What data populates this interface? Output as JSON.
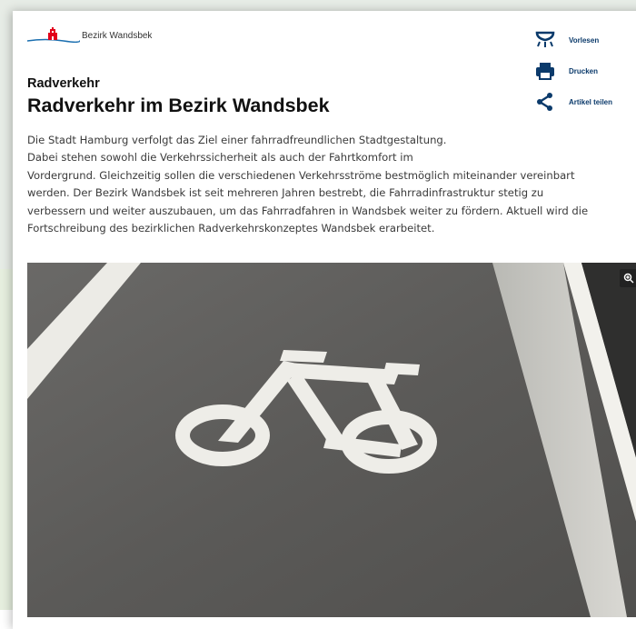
{
  "header": {
    "logo_text": "Bezirk Wandsbek",
    "brand_color": "#e2001a"
  },
  "article": {
    "kicker": "Radverkehr",
    "title": "Radverkehr im Bezirk Wandsbek",
    "paragraph_lines": [
      "Die Stadt Hamburg verfolgt das Ziel einer fahrradfreundlichen Stadtgestaltung.",
      "Dabei stehen sowohl die Verkehrssicherheit als auch der Fahrtkomfort im",
      "Vordergrund. Gleichzeitig sollen die verschiedenen Verkehrsströme bestmöglich miteinander vereinbart",
      "werden. Der Bezirk Wandsbek ist seit mehreren Jahren bestrebt, die Fahrradinfrastruktur stetig zu",
      "verbessern und weiter auszubauen, um das Fahrradfahren in Wandsbek weiter zu fördern. Aktuell wird die",
      "Fortschreibung des bezirklichen Radverkehrskonzeptes Wandsbek erarbeitet."
    ]
  },
  "actions": [
    {
      "label": "Vorlesen",
      "icon": "speaker-icon"
    },
    {
      "label": "Drucken",
      "icon": "printer-icon"
    },
    {
      "label": "Artikel teilen",
      "icon": "share-icon"
    }
  ],
  "image": {
    "description_icon": "bicycle-lane-marking",
    "zoom_icon": "zoom-icon"
  },
  "colors": {
    "action_label": "#0b3a6b",
    "icon": "#0b3a6b",
    "asphalt": "#5e5d5b"
  }
}
